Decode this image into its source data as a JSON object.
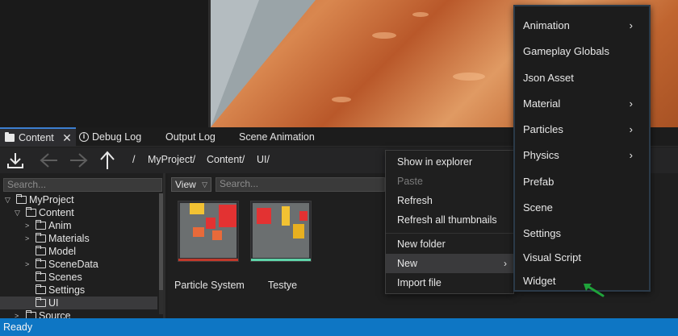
{
  "tabs": [
    {
      "label": "Content",
      "icon": "folder-icon",
      "active": true
    },
    {
      "label": "Debug Log",
      "icon": "info-icon"
    },
    {
      "label": "Output Log"
    },
    {
      "label": "Scene Animation"
    }
  ],
  "toolbar": {
    "import_icon": "download-icon",
    "back_icon": "arrow-left-icon",
    "forward_icon": "arrow-right-icon",
    "up_icon": "arrow-up-icon",
    "breadcrumb": [
      "/",
      "MyProject/",
      "Content/",
      "UI/"
    ]
  },
  "tree": {
    "search_placeholder": "Search...",
    "items": [
      {
        "label": "MyProject",
        "expanded": true
      },
      {
        "label": "Content",
        "expanded": true
      },
      {
        "label": "Anim",
        "expanded": false
      },
      {
        "label": "Materials",
        "expanded": false
      },
      {
        "label": "Model"
      },
      {
        "label": "SceneData",
        "expanded": false
      },
      {
        "label": "Scenes"
      },
      {
        "label": "Settings"
      },
      {
        "label": "UI",
        "selected": true
      },
      {
        "label": "Source",
        "expanded": false
      }
    ]
  },
  "content": {
    "view_label": "View",
    "search_placeholder": "Search...",
    "items": [
      {
        "label": "Particle System",
        "bar_color": "#c0392b"
      },
      {
        "label": "Testye",
        "bar_color": "#5fd3a8"
      }
    ]
  },
  "context_menu": {
    "items": [
      {
        "label": "Show in explorer"
      },
      {
        "label": "Paste",
        "disabled": true
      },
      {
        "label": "Refresh"
      },
      {
        "label": "Refresh all thumbnails"
      },
      {
        "label": "New folder"
      },
      {
        "label": "New",
        "has_submenu": true,
        "highlighted": true
      },
      {
        "label": "Import file"
      }
    ]
  },
  "submenu": {
    "items": [
      {
        "label": "Animation",
        "has_submenu": true
      },
      {
        "label": "Gameplay Globals"
      },
      {
        "label": "Json Asset"
      },
      {
        "label": "Material",
        "has_submenu": true
      },
      {
        "label": "Particles",
        "has_submenu": true
      },
      {
        "label": "Physics",
        "has_submenu": true
      },
      {
        "label": "Prefab"
      },
      {
        "label": "Scene"
      },
      {
        "label": "Settings"
      },
      {
        "label": "Visual Script"
      },
      {
        "label": "Widget"
      }
    ]
  },
  "status": {
    "text": "Ready"
  },
  "colors": {
    "accent": "#0e76c4",
    "annotation_arrow": "#1fa33a"
  }
}
